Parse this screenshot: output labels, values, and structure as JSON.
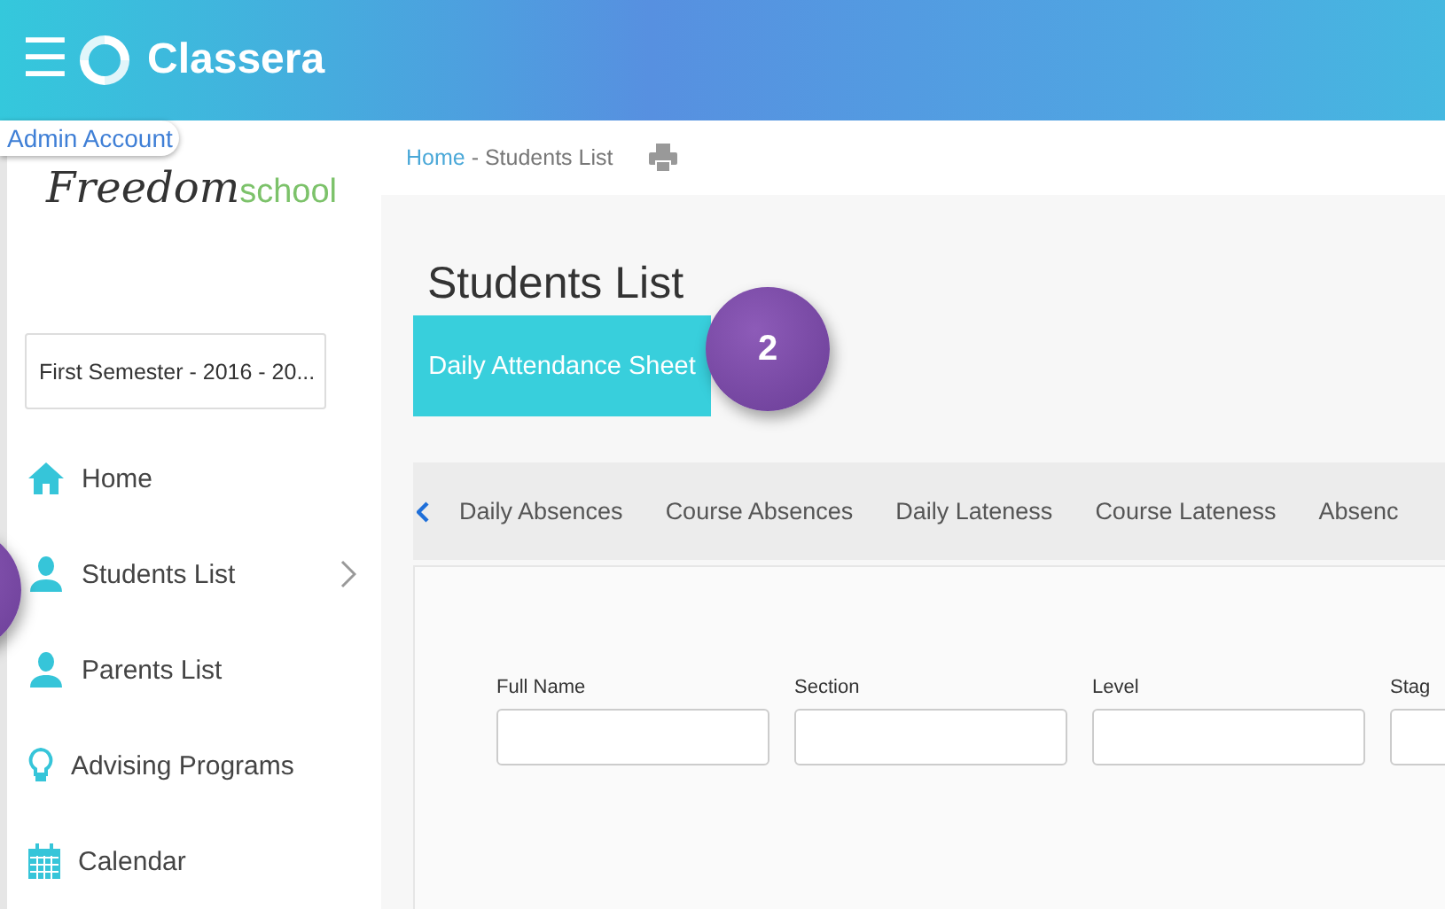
{
  "header": {
    "menu_glyph": "☰",
    "brand": "Classera"
  },
  "account_badge": "Admin Account",
  "logo": {
    "script": "Freedom",
    "plain": "school"
  },
  "semester_select": {
    "value": "First Semester - 2016 - 20..."
  },
  "sidebar": {
    "items": [
      {
        "label": "Home",
        "kind": "home",
        "has_arrow": false
      },
      {
        "label": "Students List",
        "kind": "user",
        "has_arrow": true
      },
      {
        "label": "Parents List",
        "kind": "user",
        "has_arrow": false
      },
      {
        "label": "Advising Programs",
        "kind": "bulb",
        "has_arrow": false
      },
      {
        "label": "Calendar",
        "kind": "calendar",
        "has_arrow": false
      }
    ]
  },
  "breadcrumb": {
    "home": "Home",
    "separator": " - ",
    "current": "Students List"
  },
  "page_title": "Students List",
  "action_button": "Daily Attendance Sheet",
  "callout": "2",
  "tabs": [
    "Daily Absences",
    "Course Absences",
    "Daily Lateness",
    "Course Lateness",
    "Absenc"
  ],
  "filters": [
    "Full Name",
    "Section",
    "Level",
    "Stag"
  ]
}
